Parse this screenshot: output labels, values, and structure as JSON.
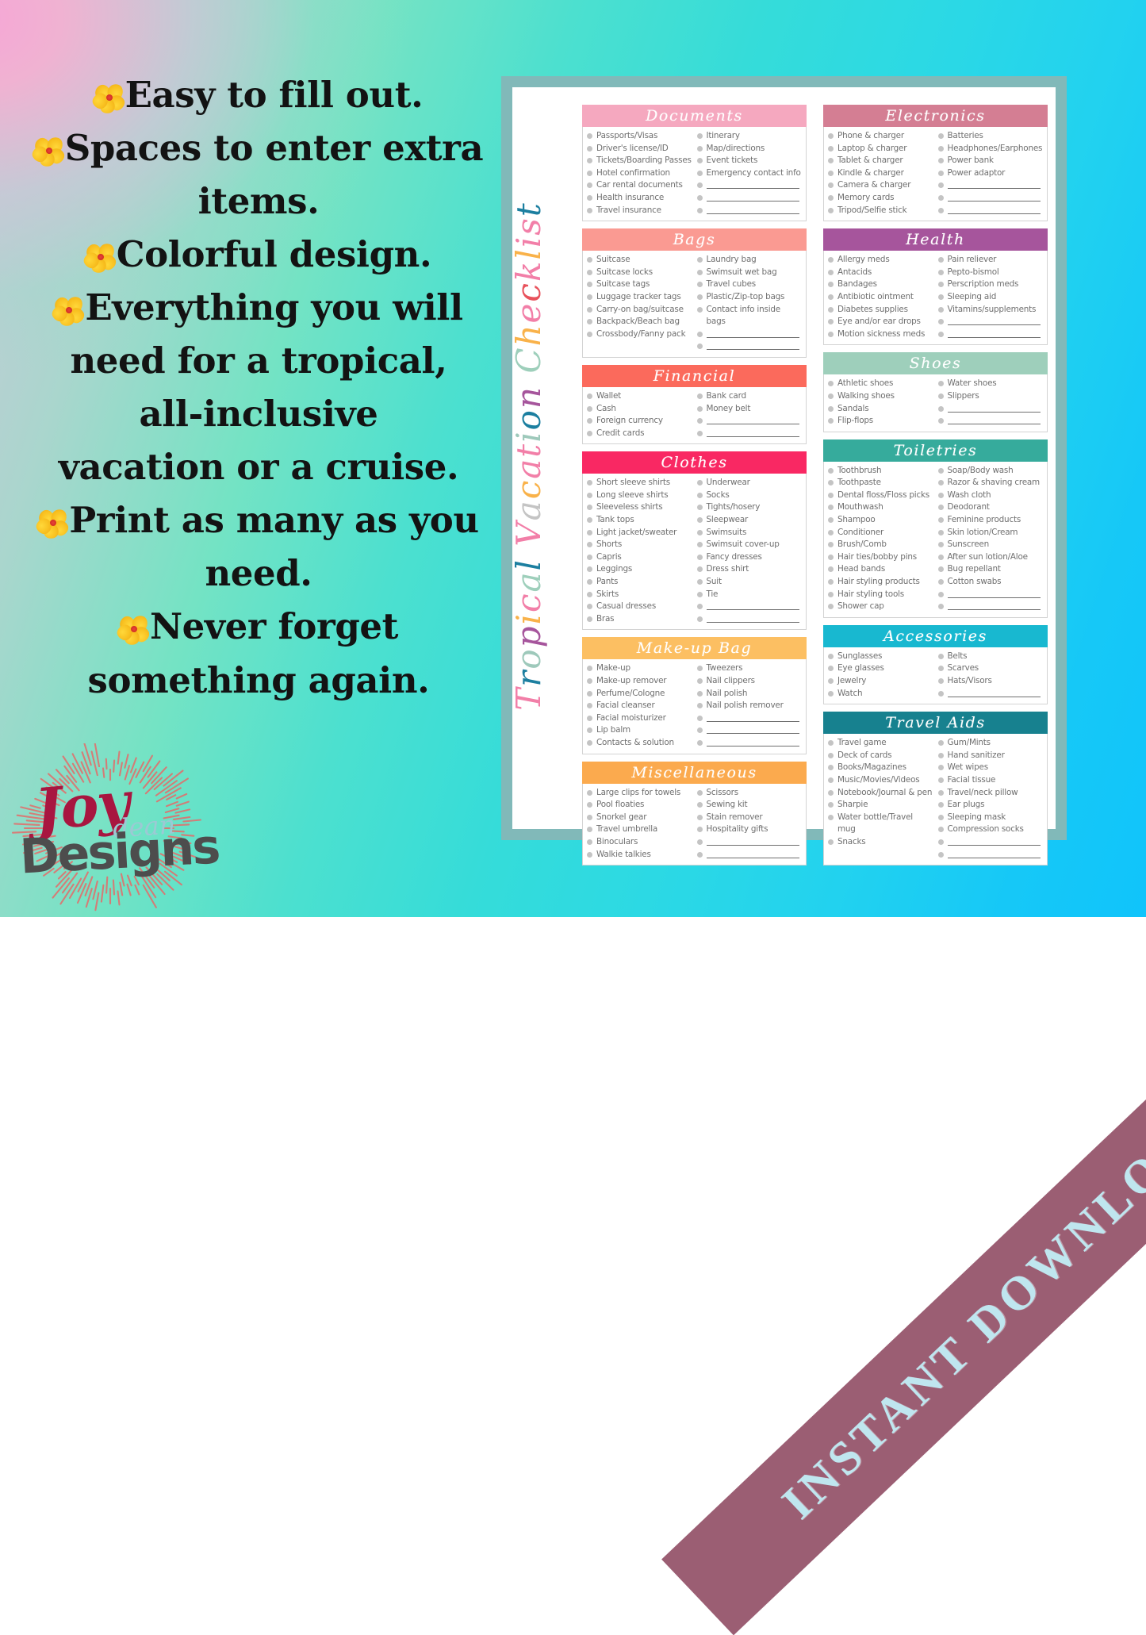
{
  "background": {
    "gradient_from": "#f0b2d2",
    "gradient_mid": "#3cddd2",
    "gradient_to": "#10c4fb"
  },
  "promo": {
    "bullet_icon": "hibiscus-flower-icon",
    "lines": [
      {
        "flower": true,
        "text": "Easy to fill out."
      },
      {
        "flower": true,
        "text": "Spaces to enter extra"
      },
      {
        "flower": false,
        "text": "items."
      },
      {
        "flower": true,
        "text": "Colorful design."
      },
      {
        "flower": true,
        "text": "Everything you will"
      },
      {
        "flower": false,
        "text": "need for a tropical,"
      },
      {
        "flower": false,
        "text": "all-inclusive"
      },
      {
        "flower": false,
        "text": "vacation or a cruise."
      },
      {
        "flower": true,
        "text": "Print as many as you"
      },
      {
        "flower": false,
        "text": "need."
      },
      {
        "flower": true,
        "text": "Never forget"
      },
      {
        "flower": false,
        "text": "something again."
      }
    ]
  },
  "logo": {
    "joy": "Joy",
    "dean": "dean",
    "designs": "Designs",
    "joy_color": "#a81640",
    "dean_color": "#9cc9d4",
    "designs_color": "#4d4d4d",
    "rays_color": "#e0706d"
  },
  "ribbon": {
    "label": "INSTANT DOWNLOAD",
    "background": "#823650",
    "text_color": "#bfe6ef"
  },
  "sheet": {
    "frame_color": "#81b9b9",
    "title": "Tropical Vacation Checklist",
    "title_letter_colors": [
      "#f27fa8",
      "#1c7fa0",
      "#9ec9bb",
      "#a6559c",
      "#f9b24a",
      "#f27fa8",
      "#9ecfbb",
      "#1c7fa0",
      "#f27fa8",
      "#c4c4c4",
      "#f9b24a",
      "#f27fa8",
      "#f27fa8",
      "#9ec9bb",
      "#1c7fa0",
      "#a6559c",
      "#9ecfbb",
      "#f9b24a",
      "#f27fa8",
      "#e8525c",
      "#f27fa8",
      "#f9b24a",
      "#f27fa8",
      "#f27fa8",
      "#1c7fa0",
      "#9ec9bb",
      "#f27fa8"
    ],
    "left_column": [
      {
        "title": "Documents",
        "color": "#f5a8bf",
        "left": [
          "Passports/Visas",
          "Driver's license/ID",
          "Tickets/Boarding Passes",
          "Hotel confirmation",
          "Car rental documents",
          "Health insurance",
          "Travel insurance"
        ],
        "right": [
          "Itinerary",
          "Map/directions",
          "Event tickets",
          "Emergency contact info"
        ],
        "right_blanks": 3
      },
      {
        "title": "Bags",
        "color": "#fa9a92",
        "left": [
          "Suitcase",
          "Suitcase locks",
          "Suitcase tags",
          "Luggage tracker tags",
          "Carry-on bag/suitcase",
          "Backpack/Beach bag",
          "Crossbody/Fanny pack"
        ],
        "right": [
          "Laundry bag",
          "Swimsuit wet bag",
          "Travel cubes",
          "Plastic/Zip-top bags",
          "Contact info inside bags"
        ],
        "right_blanks": 2
      },
      {
        "title": "Financial",
        "color": "#fb6a5c",
        "left": [
          "Wallet",
          "Cash",
          "Foreign currency",
          "Credit cards"
        ],
        "right": [
          "Bank card",
          "Money belt"
        ],
        "right_blanks": 2
      },
      {
        "title": "Clothes",
        "color": "#f92863",
        "left": [
          "Short sleeve shirts",
          "Long sleeve shirts",
          "Sleeveless shirts",
          "Tank tops",
          "Light jacket/sweater",
          "Shorts",
          "Capris",
          "Leggings",
          "Pants",
          "Skirts",
          "Casual dresses",
          "Bras"
        ],
        "right": [
          "Underwear",
          "Socks",
          "Tights/hosery",
          "Sleepwear",
          "Swimsuits",
          "Swimsuit cover-up",
          "Fancy dresses",
          "Dress shirt",
          "Suit",
          "Tie"
        ],
        "right_blanks": 2
      },
      {
        "title": "Make-up Bag",
        "color": "#fcbf62",
        "left": [
          "Make-up",
          "Make-up remover",
          "Perfume/Cologne",
          "Facial cleanser",
          "Facial moisturizer",
          "Lip balm",
          "Contacts & solution"
        ],
        "right": [
          "Tweezers",
          "Nail clippers",
          "Nail polish",
          "Nail polish remover"
        ],
        "right_blanks": 3
      },
      {
        "title": "Miscellaneous",
        "color": "#fbaa4e",
        "left": [
          "Large clips for towels",
          "Pool floaties",
          "Snorkel gear",
          "Travel umbrella",
          "Binoculars",
          "Walkie talkies"
        ],
        "right": [
          "Scissors",
          "Sewing kit",
          "Stain remover",
          "Hospitality gifts"
        ],
        "right_blanks": 2
      }
    ],
    "right_column": [
      {
        "title": "Electronics",
        "color": "#d47e93",
        "left": [
          "Phone & charger",
          "Laptop & charger",
          "Tablet & charger",
          "Kindle & charger",
          "Camera & charger",
          "Memory cards",
          "Tripod/Selfie stick"
        ],
        "right": [
          "Batteries",
          "Headphones/Earphones",
          "Power bank",
          "Power adaptor"
        ],
        "right_blanks": 3
      },
      {
        "title": "Health",
        "color": "#a6559c",
        "left": [
          "Allergy meds",
          "Antacids",
          "Bandages",
          "Antibiotic ointment",
          "Diabetes supplies",
          "Eye and/or ear drops",
          "Motion sickness meds"
        ],
        "right": [
          "Pain reliever",
          "Pepto-bismol",
          "Perscription meds",
          "Sleeping aid",
          "Vitamins/supplements"
        ],
        "right_blanks": 2
      },
      {
        "title": "Shoes",
        "color": "#9ecfbb",
        "left": [
          "Athletic shoes",
          "Walking shoes",
          "Sandals",
          "Flip-flops"
        ],
        "right": [
          "Water shoes",
          "Slippers"
        ],
        "right_blanks": 2
      },
      {
        "title": "Toiletries",
        "color": "#36ab9c",
        "left": [
          "Toothbrush",
          "Toothpaste",
          "Dental floss/Floss picks",
          "Mouthwash",
          "Shampoo",
          "Conditioner",
          "Brush/Comb",
          "Hair ties/bobby pins",
          "Head bands",
          "Hair styling products",
          "Hair styling tools",
          "Shower cap"
        ],
        "right": [
          "Soap/Body wash",
          "Razor & shaving cream",
          "Wash cloth",
          "Deodorant",
          "Feminine products",
          "Skin lotion/Cream",
          "Sunscreen",
          "After sun lotion/Aloe",
          "Bug repellant",
          "Cotton swabs"
        ],
        "right_blanks": 2
      },
      {
        "title": "Accessories",
        "color": "#18b8d0",
        "left": [
          "Sunglasses",
          "Eye glasses",
          "Jewelry",
          "Watch"
        ],
        "right": [
          "Belts",
          "Scarves",
          "Hats/Visors"
        ],
        "right_blanks": 1
      },
      {
        "title": "Travel Aids",
        "color": "#17818f",
        "left": [
          "Travel game",
          "Deck of cards",
          "Books/Magazines",
          "Music/Movies/Videos",
          "Notebook/Journal & pen",
          "Sharpie",
          "Water bottle/Travel mug",
          "Snacks"
        ],
        "right": [
          "Gum/Mints",
          "Hand sanitizer",
          "Wet wipes",
          "Facial tissue",
          "Travel/neck pillow",
          "Ear plugs",
          "Sleeping mask",
          "Compression socks"
        ],
        "right_blanks": 2
      }
    ]
  }
}
